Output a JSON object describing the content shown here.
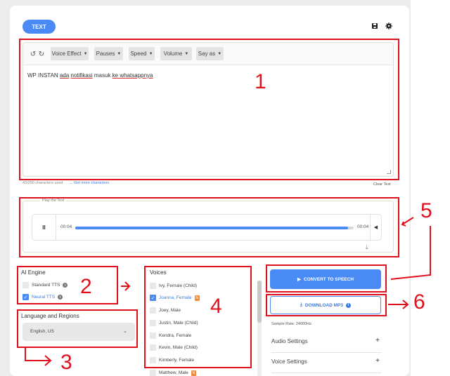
{
  "header": {
    "tab_label": "TEXT",
    "save_icon": "save-icon",
    "settings_icon": "gear-icon"
  },
  "editor": {
    "toolbar": [
      "Voice Effect",
      "Pauses",
      "Speed",
      "Volume",
      "Say as"
    ],
    "text_plain": "WP INSTAN ",
    "text_u1": "ada",
    "text_sp1": " ",
    "text_u2": "notifikasi",
    "text_mid": " masuk ",
    "text_u3": "ke whatsappnya",
    "chars_used": "43/250 characters used",
    "get_more": "Get more characters",
    "clear": "Clear Text"
  },
  "player": {
    "legend": "Play the Text",
    "pause_glyph": "II",
    "time_left": "00:04",
    "time_right": "00:04",
    "progress": 0.98
  },
  "ai_engine": {
    "title": "AI Engine",
    "standard": "Standard TTS",
    "neural": "Neural TTS"
  },
  "language": {
    "title": "Language and Regions",
    "value": "English, US"
  },
  "voices": {
    "title": "Voices",
    "items": [
      {
        "label": "Ivy, Female (Child)"
      },
      {
        "label": "Joanna, Female"
      },
      {
        "label": "Joey, Male"
      },
      {
        "label": "Justin, Male (Child)"
      },
      {
        "label": "Kendra, Female"
      },
      {
        "label": "Kevin, Male (Child)"
      },
      {
        "label": "Kimberly, Female"
      },
      {
        "label": "Matthew, Male"
      }
    ]
  },
  "actions": {
    "convert": "CONVERT TO SPEECH",
    "download": "DOWNLOAD MP3",
    "sample_rate": "Sample Rate: 24000Hz",
    "audio_settings": "Audio Settings",
    "voice_settings": "Voice Settings"
  },
  "callouts": [
    "1",
    "2",
    "3",
    "4",
    "5",
    "6"
  ],
  "colors": {
    "accent": "#4a8af4",
    "annotation": "#e0101c"
  }
}
